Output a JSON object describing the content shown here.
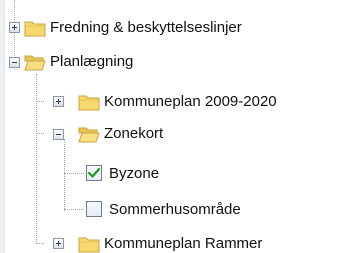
{
  "tree": {
    "items": [
      {
        "label": "Fredning & beskyttelseslinjer",
        "type": "folder",
        "state": "collapsed",
        "icon": "folder-closed-icon"
      },
      {
        "label": "Planlægning",
        "type": "folder",
        "state": "expanded",
        "icon": "folder-open-icon"
      },
      {
        "label": "Kommuneplan 2009-2020",
        "type": "folder",
        "state": "collapsed",
        "icon": "folder-closed-icon"
      },
      {
        "label": "Zonekort",
        "type": "folder",
        "state": "expanded",
        "icon": "folder-open-icon"
      },
      {
        "label": "Byzone",
        "type": "layer",
        "checked": true
      },
      {
        "label": "Sommerhusområde",
        "type": "layer",
        "checked": false
      },
      {
        "label": "Kommuneplan Rammer",
        "type": "folder",
        "state": "collapsed",
        "icon": "folder-closed-icon"
      }
    ]
  },
  "colors": {
    "folder_fill": "#f6d86d",
    "folder_stroke": "#c9a43b",
    "check_mark": "#1f9a1f",
    "tree_lines": "#a7a7a7"
  }
}
